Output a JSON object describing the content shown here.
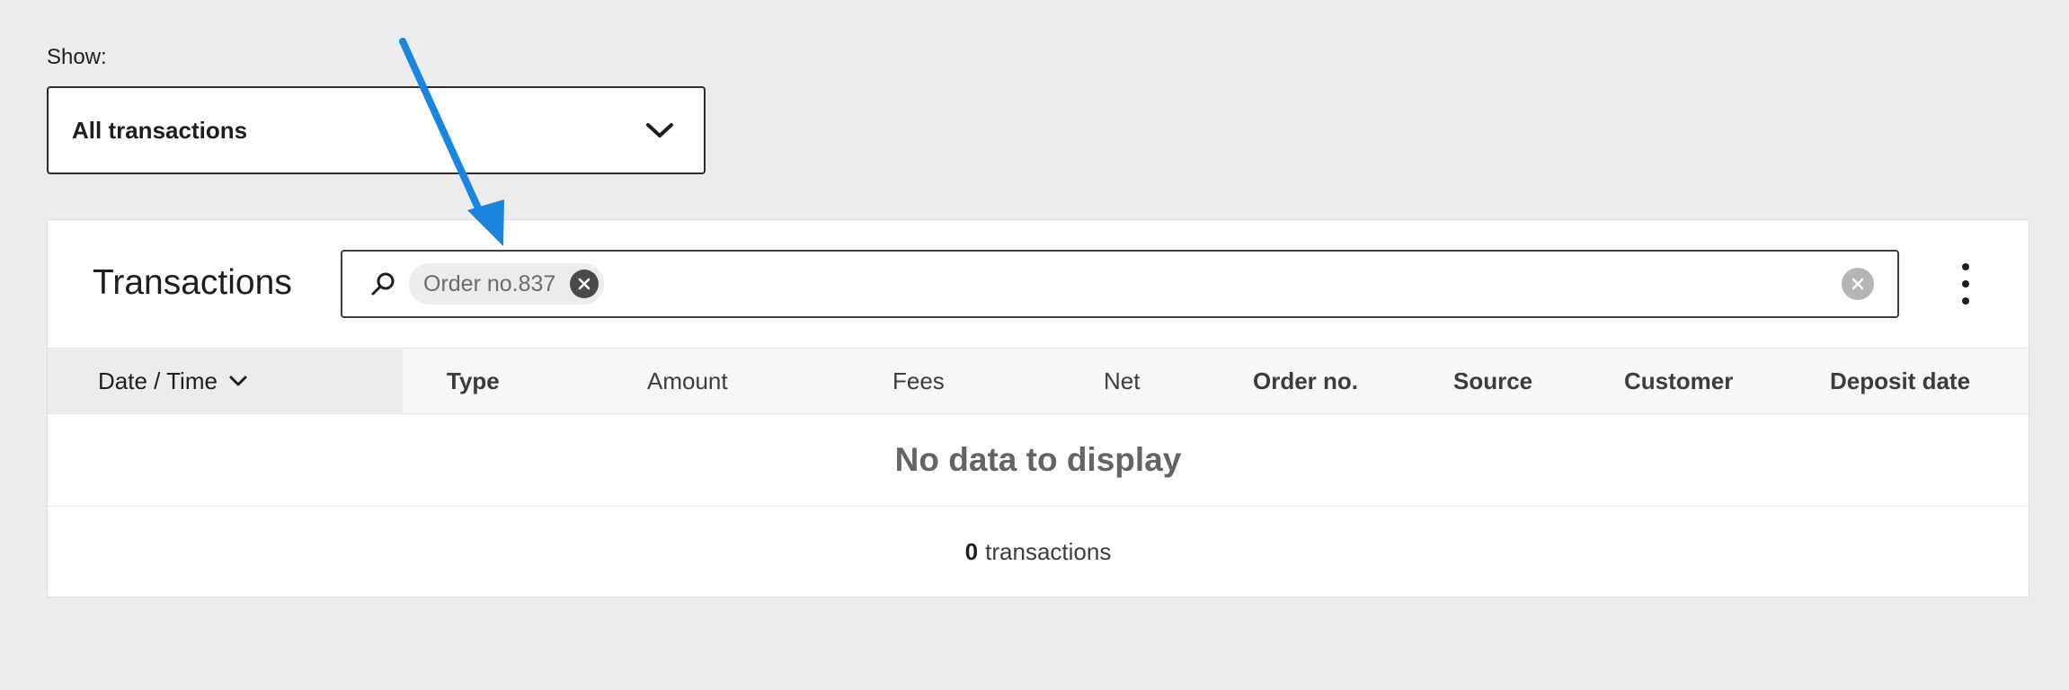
{
  "filter": {
    "show_label": "Show:",
    "selected": "All transactions"
  },
  "card": {
    "title": "Transactions",
    "search": {
      "chip_label": "Order no.837"
    }
  },
  "table": {
    "columns": [
      "Date / Time",
      "Type",
      "Amount",
      "Fees",
      "Net",
      "Order no.",
      "Source",
      "Customer",
      "Deposit date"
    ],
    "sorted_column": "Date / Time",
    "sort_direction": "descending",
    "empty_message": "No data to display"
  },
  "footer": {
    "count": "0",
    "count_label": "transactions"
  },
  "annotation": {
    "arrow_color": "#1a85e0"
  }
}
